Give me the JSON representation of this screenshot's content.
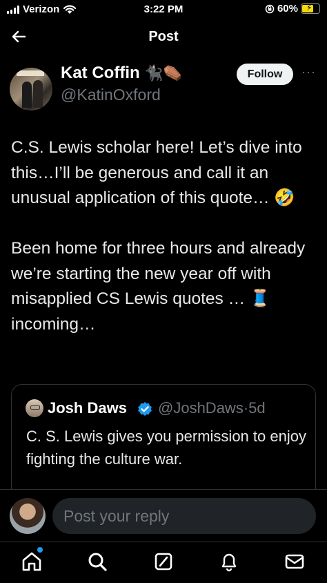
{
  "status_bar": {
    "carrier": "Verizon",
    "time": "3:22 PM",
    "battery": "60%",
    "battery_level": 0.6,
    "icons": [
      "signal-icon",
      "wifi-icon",
      "orientation-lock-icon",
      "battery-charging-icon"
    ]
  },
  "header": {
    "title": "Post",
    "back_icon": "arrow-left-icon"
  },
  "author": {
    "name": "Kat Coffin",
    "name_emoji": "🐈‍⬛⚰️",
    "handle": "@KatinOxford",
    "follow_label": "Follow",
    "more_icon": "more-horizontal-icon"
  },
  "tweet": {
    "paragraph1": "C.S. Lewis scholar here! Let’s dive into this…I’ll be generous and call it an unusual application of this quote… 🤣",
    "paragraph2": "Been home for three hours and already we’re starting the new year off with misapplied CS Lewis quotes … 🧵 incoming…"
  },
  "quote": {
    "name": "Josh Daws",
    "handle": "@JoshDaws",
    "separator": "·",
    "time": "5d",
    "text": "C. S. Lewis gives you permission to enjoy fighting the culture war.",
    "verified_color": "#1d9bf0"
  },
  "reply": {
    "placeholder": "Post your reply"
  },
  "tabbar": {
    "items": [
      "home-icon",
      "search-icon",
      "grok-icon",
      "notifications-icon",
      "messages-icon"
    ],
    "home_has_notification": true
  },
  "colors": {
    "background": "#000000",
    "accent": "#1d9bf0",
    "secondary_text": "#71767b"
  }
}
